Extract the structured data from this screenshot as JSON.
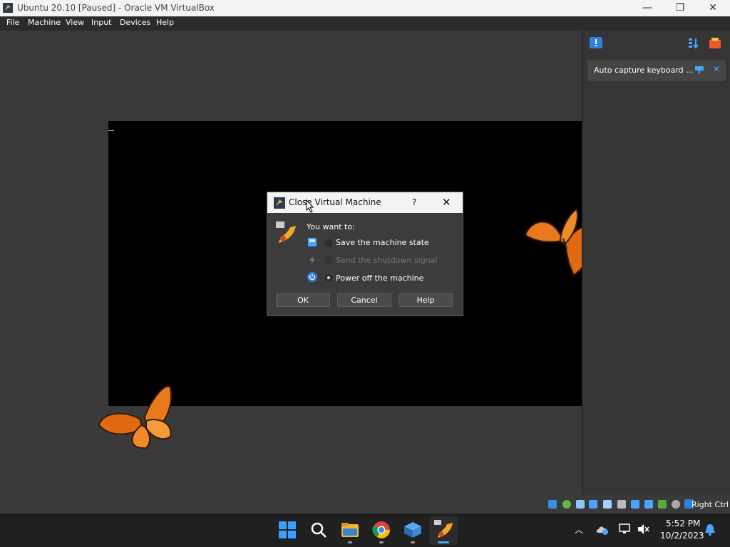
{
  "window": {
    "title": "Ubuntu 20.10 [Paused] - Oracle VM VirtualBox",
    "controls": {
      "minimize_icon": "minimize-icon",
      "maximize_icon": "restore-icon",
      "close_icon": "close-icon"
    }
  },
  "menubar": {
    "items": [
      "File",
      "Machine",
      "View",
      "Input",
      "Devices",
      "Help"
    ]
  },
  "notification_panel": {
    "message": "Auto capture keyboard ..."
  },
  "dialog": {
    "title": "Close Virtual Machine",
    "help_glyph": "?",
    "prompt": "You want to:",
    "options": [
      {
        "label": "Save the machine state",
        "enabled": true,
        "checked": false
      },
      {
        "label": "Send the shutdown signal",
        "enabled": false,
        "checked": false
      },
      {
        "label": "Power off the machine",
        "enabled": true,
        "checked": true
      }
    ],
    "buttons": {
      "ok": "OK",
      "cancel": "Cancel",
      "help": "Help"
    }
  },
  "statusbar": {
    "host_key": "Right Ctrl"
  },
  "taskbar": {
    "time": "5:52 PM",
    "date": "10/2/2023"
  },
  "colors": {
    "accent": "#0078d4",
    "dialog_bg": "#3c3c3c",
    "vm_bg": "#3a3a3a"
  }
}
